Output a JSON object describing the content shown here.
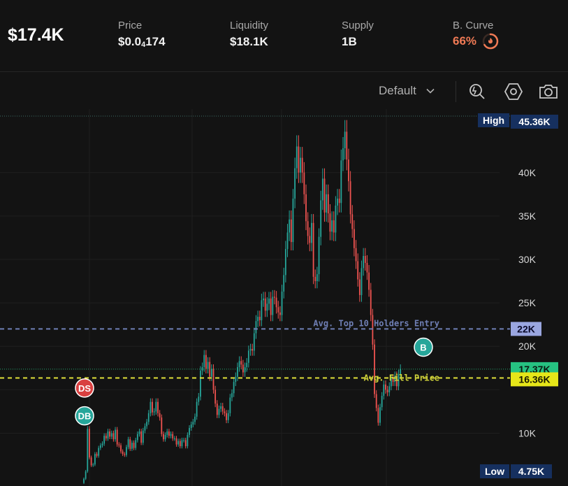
{
  "header": {
    "market_cap": "$17.4K",
    "stats": [
      {
        "label": "Price",
        "value_prefix": "$0.0",
        "value_sub": "4",
        "value_suffix": "174"
      },
      {
        "label": "Liquidity",
        "value": "$18.1K"
      },
      {
        "label": "Supply",
        "value": "1B"
      },
      {
        "label": "B. Curve",
        "value": "66%",
        "progress": 0.66
      }
    ]
  },
  "toolbar": {
    "preset_label": "Default",
    "icons": [
      "indicator-icon",
      "settings-hex-icon",
      "camera-icon"
    ]
  },
  "colors": {
    "up": "#26a69a",
    "down": "#ef5350",
    "background": "#131313",
    "top10_line": "#6f7fb5",
    "fill_line": "#e0e03a",
    "last_price": "#26c281",
    "curve_accent": "#f07a55"
  },
  "chart_data": {
    "type": "line",
    "ylim": [
      4000,
      46500
    ],
    "y_ticks": [
      {
        "value": 40000,
        "label": "40K"
      },
      {
        "value": 35000,
        "label": "35K"
      },
      {
        "value": 30000,
        "label": "30K"
      },
      {
        "value": 25000,
        "label": "25K"
      },
      {
        "value": 20000,
        "label": "20K"
      },
      {
        "value": 10000,
        "label": "10K"
      }
    ],
    "series": [
      {
        "values": [
          4.75,
          5.6,
          10.5,
          7.2,
          6.3,
          6.4,
          7.6,
          7.4,
          8.3,
          8.6,
          8.8,
          9.7,
          9.4,
          10.2,
          9.6,
          10.0,
          9.3,
          10.4,
          8.7,
          8.6,
          7.9,
          7.6,
          7.5,
          8.4,
          9.3,
          8.2,
          8.9,
          8.3,
          9.2,
          9.9,
          10.2,
          8.9,
          10.3,
          10.8,
          11.3,
          12.3,
          13.6,
          12.4,
          12.5,
          13.6,
          12.3,
          11.8,
          9.9,
          9.3,
          9.8,
          10.2,
          9.7,
          9.9,
          9.4,
          9.4,
          8.7,
          9.1,
          8.5,
          9.2,
          9.2,
          8.5,
          9.8,
          10.6,
          11.0,
          11.3,
          11.9,
          13.6,
          14.2,
          17.2,
          17.6,
          19.0,
          17.4,
          18.2,
          16.5,
          17.4,
          15.0,
          13.4,
          12.1,
          12.8,
          13.1,
          12.5,
          12.3,
          11.5,
          12.3,
          14.1,
          14.6,
          15.9,
          16.5,
          17.6,
          18.3,
          17.9,
          17.0,
          17.6,
          18.1,
          19.5,
          19.7,
          19.5,
          21.5,
          22.9,
          23.4,
          23.0,
          25.3,
          25.5,
          24.1,
          24.9,
          25.5,
          23.6,
          25.7,
          25.6,
          24.5,
          23.9,
          23.6,
          26.3,
          28.2,
          31.2,
          33.1,
          34.6,
          32.0,
          37.0,
          40.5,
          43.0,
          40.0,
          41.7,
          40.0,
          37.5,
          34.4,
          32.7,
          31.9,
          34.2,
          28.0,
          27.5,
          28.3,
          32.6,
          36.8,
          39.3,
          35.4,
          37.5,
          35.3,
          33.2,
          34.5,
          33.1,
          36.2,
          37.0,
          36.5,
          41.4,
          42.8,
          44.7,
          41.5,
          39.0,
          35.2,
          33.5,
          31.3,
          29.8,
          27.7,
          25.9,
          29.0,
          30.4,
          29.6,
          28.5,
          26.5,
          23.6,
          20.2,
          14.5,
          12.9,
          11.2,
          13.0,
          14.3,
          15.6,
          15.0,
          14.7,
          15.4,
          16.3,
          15.9,
          16.6,
          15.4,
          16.8,
          17.4
        ]
      }
    ],
    "high": {
      "label": "High",
      "value": "45.36K"
    },
    "low": {
      "label": "Low",
      "value": "4.75K"
    },
    "last_price": {
      "value": 17370,
      "label": "17.37K"
    },
    "levels": [
      {
        "name": "Avg. Top 10 Holders Entry",
        "value": 22000,
        "label": "22K"
      },
      {
        "name": "Avg. Fill Price",
        "value": 16360,
        "label": "16.36K"
      }
    ],
    "trade_markers": [
      {
        "label": "DS",
        "index": 0,
        "value": 15200,
        "kind": "dev-sell"
      },
      {
        "label": "DB",
        "index": 0,
        "value": 12000,
        "kind": "dev-buy"
      },
      {
        "label": "B",
        "index": 170,
        "value": 19900,
        "kind": "buy"
      }
    ]
  }
}
